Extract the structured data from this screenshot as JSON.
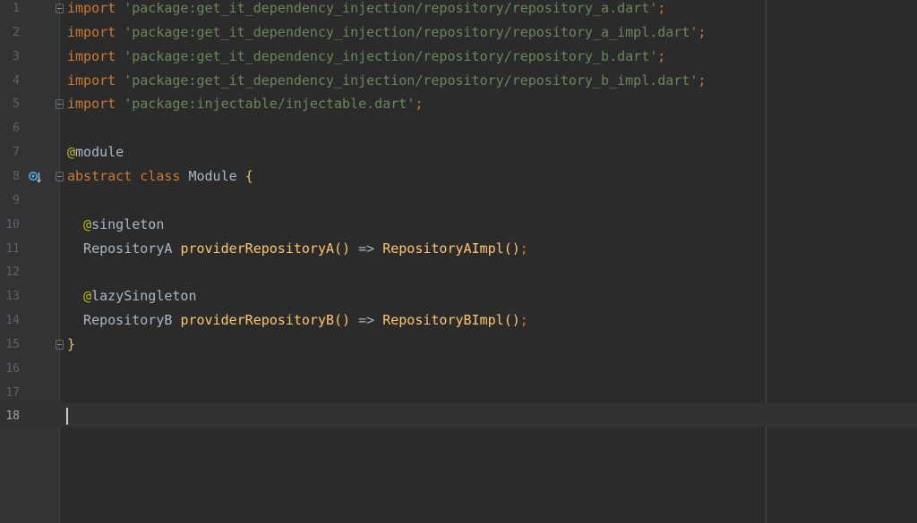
{
  "editor": {
    "lines": [
      {
        "number": "1",
        "tokens": [
          {
            "t": "import",
            "c": "kw"
          },
          {
            "t": " ",
            "c": ""
          },
          {
            "t": "'package:get_it_dependency_injection/repository/repository_a.dart'",
            "c": "str"
          },
          {
            "t": ";",
            "c": "kw"
          }
        ]
      },
      {
        "number": "2",
        "tokens": [
          {
            "t": "import",
            "c": "kw"
          },
          {
            "t": " ",
            "c": ""
          },
          {
            "t": "'package:get_it_dependency_injection/repository/repository_a_impl.dart'",
            "c": "str"
          },
          {
            "t": ";",
            "c": "kw"
          }
        ]
      },
      {
        "number": "3",
        "tokens": [
          {
            "t": "import",
            "c": "kw"
          },
          {
            "t": " ",
            "c": ""
          },
          {
            "t": "'package:get_it_dependency_injection/repository/repository_b.dart'",
            "c": "str"
          },
          {
            "t": ";",
            "c": "kw"
          }
        ]
      },
      {
        "number": "4",
        "tokens": [
          {
            "t": "import",
            "c": "kw"
          },
          {
            "t": " ",
            "c": ""
          },
          {
            "t": "'package:get_it_dependency_injection/repository/repository_b_impl.dart'",
            "c": "str"
          },
          {
            "t": ";",
            "c": "kw"
          }
        ]
      },
      {
        "number": "5",
        "tokens": [
          {
            "t": "import",
            "c": "kw"
          },
          {
            "t": " ",
            "c": ""
          },
          {
            "t": "'package:injectable/injectable.dart'",
            "c": "str"
          },
          {
            "t": ";",
            "c": "kw"
          }
        ]
      },
      {
        "number": "6",
        "tokens": []
      },
      {
        "number": "7",
        "tokens": [
          {
            "t": "@",
            "c": "ann"
          },
          {
            "t": "module",
            "c": ""
          }
        ]
      },
      {
        "number": "8",
        "tokens": [
          {
            "t": "abstract",
            "c": "kw"
          },
          {
            "t": " ",
            "c": ""
          },
          {
            "t": "class",
            "c": "kw"
          },
          {
            "t": " Module ",
            "c": ""
          },
          {
            "t": "{",
            "c": "brace"
          }
        ]
      },
      {
        "number": "9",
        "tokens": []
      },
      {
        "number": "10",
        "tokens": [
          {
            "t": "  ",
            "c": ""
          },
          {
            "t": "@",
            "c": "ann"
          },
          {
            "t": "singleton",
            "c": ""
          }
        ]
      },
      {
        "number": "11",
        "tokens": [
          {
            "t": "  RepositoryA ",
            "c": ""
          },
          {
            "t": "providerRepositoryA",
            "c": "fn"
          },
          {
            "t": "()",
            "c": "fn"
          },
          {
            "t": " => ",
            "c": ""
          },
          {
            "t": "RepositoryAImpl",
            "c": "fn"
          },
          {
            "t": "()",
            "c": "fn"
          },
          {
            "t": ";",
            "c": "kw"
          }
        ]
      },
      {
        "number": "12",
        "tokens": []
      },
      {
        "number": "13",
        "tokens": [
          {
            "t": "  ",
            "c": ""
          },
          {
            "t": "@",
            "c": "ann"
          },
          {
            "t": "lazySingleton",
            "c": ""
          }
        ]
      },
      {
        "number": "14",
        "tokens": [
          {
            "t": "  RepositoryB ",
            "c": ""
          },
          {
            "t": "providerRepositoryB",
            "c": "fn"
          },
          {
            "t": "()",
            "c": "fn"
          },
          {
            "t": " => ",
            "c": ""
          },
          {
            "t": "RepositoryBImpl",
            "c": "fn"
          },
          {
            "t": "()",
            "c": "fn"
          },
          {
            "t": ";",
            "c": "kw"
          }
        ]
      },
      {
        "number": "15",
        "tokens": [
          {
            "t": "}",
            "c": "brace"
          }
        ]
      },
      {
        "number": "16",
        "tokens": []
      },
      {
        "number": "17",
        "tokens": []
      },
      {
        "number": "18",
        "tokens": []
      }
    ],
    "active_line": "18",
    "fold_markers": [
      "1",
      "5",
      "8",
      "15"
    ],
    "gutter_icons": [
      {
        "line": "8",
        "icon": "implemented-by-icon"
      }
    ]
  },
  "colors": {
    "background": "#2b2b2b",
    "gutter": "#313335",
    "keyword": "#cc7832",
    "string": "#6a8759",
    "annotation": "#bbb529",
    "function": "#ffc66d",
    "text": "#a9b7c6",
    "line_number": "#606366"
  }
}
